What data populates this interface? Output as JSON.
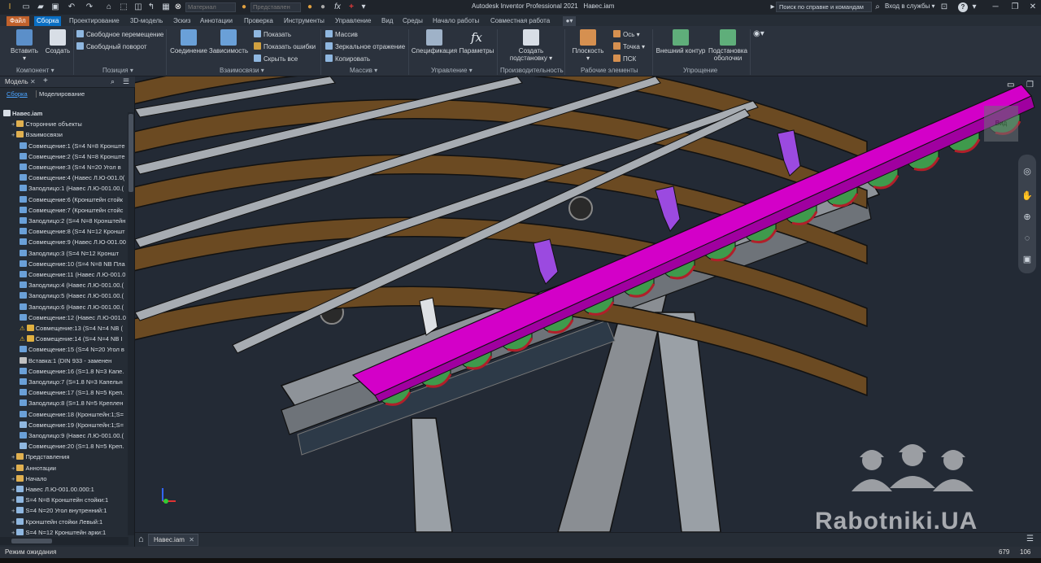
{
  "app": {
    "title": "Autodesk Inventor Professional 2021",
    "document": "Навес.iam"
  },
  "titlebar": {
    "material": "Материал",
    "appearance": "Представлен",
    "search_placeholder": "Поиск по справке и командам",
    "signin": "Вход в службы",
    "help": "?"
  },
  "tabs": [
    {
      "label": "Файл",
      "kind": "file"
    },
    {
      "label": "Сборка",
      "kind": "active"
    },
    {
      "label": "Проектирование"
    },
    {
      "label": "3D-модель"
    },
    {
      "label": "Эскиз"
    },
    {
      "label": "Аннотации"
    },
    {
      "label": "Проверка"
    },
    {
      "label": "Инструменты"
    },
    {
      "label": "Управление"
    },
    {
      "label": "Вид"
    },
    {
      "label": "Среды"
    },
    {
      "label": "Начало работы"
    },
    {
      "label": "Совместная работа"
    }
  ],
  "ribbon": {
    "insert": "Вставить",
    "create": "Создать",
    "free_move": "Свободное перемещение",
    "free_rotate": "Свободный поворот",
    "joint": "Соединение",
    "constraint": "Зависимость",
    "show": "Показать",
    "show_errors": "Показать ошибки",
    "hide_all": "Скрыть все",
    "pattern": "Массив",
    "mirror": "Зеркальное отражение",
    "copy": "Копировать",
    "spec": "Спецификация",
    "params": "Параметры",
    "create_sub1": "Создать",
    "create_sub2": "подстановку",
    "plane": "Плоскость",
    "axis": "Ось",
    "point": "Точка",
    "ucs": "ПСК",
    "outer_contour": "Внешний контур",
    "sub_shell1": "Подстановка",
    "sub_shell2": "оболочки",
    "groups": {
      "component": "Компонент",
      "position": "Позиция",
      "relations": "Взаимосвязи",
      "pattern": "Массив",
      "manage": "Управление",
      "productivity": "Производительность",
      "work": "Рабочие элементы",
      "simplify": "Упрощение"
    }
  },
  "browser": {
    "tab_model": "Модель",
    "tab_add": "+",
    "sub_assembly": "Сборка",
    "sub_modeling": "Моделирование",
    "rows": [
      {
        "t": "Навес.iam",
        "lvl": 0,
        "k": "root"
      },
      {
        "t": "Сторонние объекты",
        "lvl": 1,
        "k": "folder"
      },
      {
        "t": "Взаимосвязи",
        "lvl": 1,
        "k": "folder"
      },
      {
        "t": "Совмещение:1 (S=4 N=8 Кронште",
        "lvl": 2,
        "k": "c"
      },
      {
        "t": "Совмещение:2 (S=4 N=8 Кронште",
        "lvl": 2,
        "k": "c"
      },
      {
        "t": "Совмещение:3 (S=4 N=20 Угол в",
        "lvl": 2,
        "k": "c"
      },
      {
        "t": "Совмещение:4 (Навес Л.Ю-001.0(",
        "lvl": 2,
        "k": "c"
      },
      {
        "t": "Заподлицо:1 (Навес Л.Ю-001.00.(",
        "lvl": 2,
        "k": "c"
      },
      {
        "t": "Совмещение:6 (Кронштейн стойк",
        "lvl": 2,
        "k": "c"
      },
      {
        "t": "Совмещение:7 (Кронштейн стойс",
        "lvl": 2,
        "k": "c"
      },
      {
        "t": "Заподлицо:2 (S=4 N=8 Кронштейн",
        "lvl": 2,
        "k": "c"
      },
      {
        "t": "Совмещение:8 (S=4 N=12 Кроншт",
        "lvl": 2,
        "k": "c"
      },
      {
        "t": "Совмещение:9 (Навес Л.Ю-001.00",
        "lvl": 2,
        "k": "c"
      },
      {
        "t": "Заподлицо:3 (S=4 N=12 Кроншт",
        "lvl": 2,
        "k": "c"
      },
      {
        "t": "Совмещение:10 (S=4 N=8 NB Пла",
        "lvl": 2,
        "k": "c"
      },
      {
        "t": "Совмещение:11 (Навес Л.Ю-001.0",
        "lvl": 2,
        "k": "c"
      },
      {
        "t": "Заподлицо:4 (Навес Л.Ю-001.00.(",
        "lvl": 2,
        "k": "c"
      },
      {
        "t": "Заподлицо:5 (Навес Л.Ю-001.00.(",
        "lvl": 2,
        "k": "c"
      },
      {
        "t": "Заподлицо:6 (Навес Л.Ю-001.00.(",
        "lvl": 2,
        "k": "c"
      },
      {
        "t": "Совмещение:12 (Навес Л.Ю-001.0",
        "lvl": 2,
        "k": "c"
      },
      {
        "t": "Совмещение:13 (S=4 N=4 NB (",
        "lvl": 2,
        "k": "w"
      },
      {
        "t": "Совмещение:14 (S=4 N=4 NB I",
        "lvl": 2,
        "k": "w"
      },
      {
        "t": "Совмещение:15 (S=4 N=20 Угол в",
        "lvl": 2,
        "k": "c"
      },
      {
        "t": "Вставка:1 (DIN 933 - заменен",
        "lvl": 2,
        "k": "i"
      },
      {
        "t": "Совмещение:16 (S=1.8 N=3 Капе.",
        "lvl": 2,
        "k": "c"
      },
      {
        "t": "Заподлицо:7 (S=1.8 N=3 Капельн",
        "lvl": 2,
        "k": "c"
      },
      {
        "t": "Совмещение:17 (S=1.8 N=5 Креп.",
        "lvl": 2,
        "k": "c"
      },
      {
        "t": "Заподлицо:8 (S=1.8 N=5 Креплен",
        "lvl": 2,
        "k": "c"
      },
      {
        "t": "Совмещение:18 (Кронштейн:1;S=",
        "lvl": 2,
        "k": "c"
      },
      {
        "t": "Совмещение:19 (Кронштейн:1;S=",
        "lvl": 2,
        "k": "l"
      },
      {
        "t": "Заподлицо:9 (Навес Л.Ю-001.00.(",
        "lvl": 2,
        "k": "c"
      },
      {
        "t": "Совмещение:20 (S=1.8 N=5 Креп.",
        "lvl": 2,
        "k": "l"
      },
      {
        "t": "Представления",
        "lvl": 1,
        "k": "folder"
      },
      {
        "t": "Аннотации",
        "lvl": 1,
        "k": "folder"
      },
      {
        "t": "Начало",
        "lvl": 1,
        "k": "folder"
      },
      {
        "t": "Навес Л.Ю-001.00.000:1",
        "lvl": 1,
        "k": "part"
      },
      {
        "t": "S=4 N=8 Кронштейн стойки:1",
        "lvl": 1,
        "k": "part"
      },
      {
        "t": "S=4 N=20 Угол внутренний:1",
        "lvl": 1,
        "k": "part"
      },
      {
        "t": "Кронштейн стойки Левый:1",
        "lvl": 1,
        "k": "part"
      },
      {
        "t": "S=4 N=12 Кронштейн арки:1",
        "lvl": 1,
        "k": "part"
      }
    ]
  },
  "viewcube": {
    "label": "Вид"
  },
  "doctab": {
    "label": "Навес.iam"
  },
  "watermark": "Rabotniki.UA",
  "status": {
    "text": "Режим ожидания",
    "n1": "679",
    "n2": "106"
  },
  "colors": {
    "accent": "#0a6fc4",
    "file_tab": "#c0612c",
    "beam": "#6b4a22",
    "gutter": "#e000d6",
    "panel": "#3f9a4c",
    "bracket": "#a046e0"
  }
}
